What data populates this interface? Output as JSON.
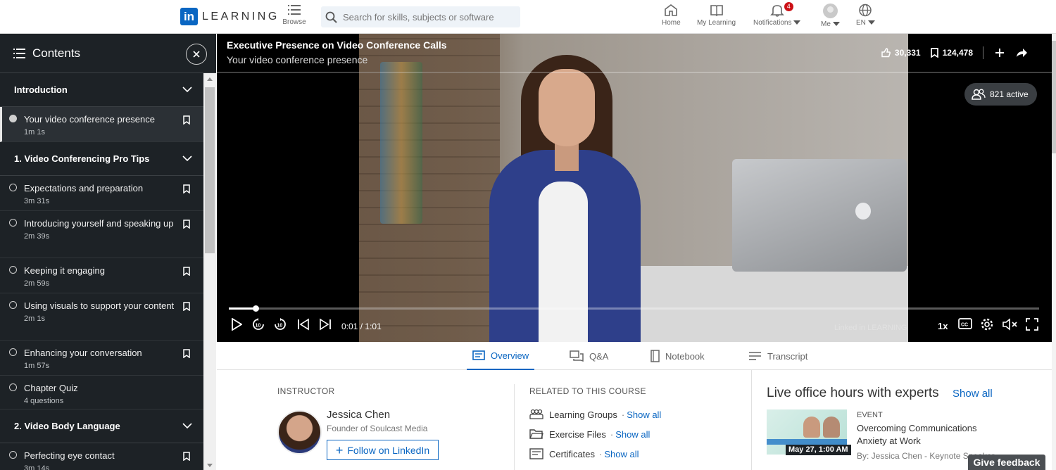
{
  "nav": {
    "logo_letters": "in",
    "logo_text": "LEARNING",
    "browse_label": "Browse",
    "search_placeholder": "Search for skills, subjects or software",
    "home_label": "Home",
    "my_learning_label": "My Learning",
    "notifications_label": "Notifications",
    "notifications_count": "4",
    "me_label": "Me",
    "lang_label": "EN"
  },
  "sidebar": {
    "title": "Contents",
    "sections": [
      {
        "title": "Introduction",
        "items": [
          {
            "title": "Your video conference presence",
            "duration": "1m 1s"
          }
        ]
      },
      {
        "title": "1. Video Conferencing Pro Tips",
        "items": [
          {
            "title": "Expectations and preparation",
            "duration": "3m 31s"
          },
          {
            "title": "Introducing yourself and speaking up",
            "duration": "2m 39s"
          },
          {
            "title": "Keeping it engaging",
            "duration": "2m 59s"
          },
          {
            "title": "Using visuals to support your content",
            "duration": "2m 1s"
          },
          {
            "title": "Enhancing your conversation",
            "duration": "1m 57s"
          },
          {
            "title": "Chapter Quiz",
            "duration": "4 questions"
          }
        ]
      },
      {
        "title": "2. Video Body Language",
        "items": [
          {
            "title": "Perfecting eye contact",
            "duration": "3m 14s"
          }
        ]
      }
    ]
  },
  "video": {
    "course_title": "Executive Presence on Video Conference Calls",
    "video_title": "Your video conference presence",
    "likes": "30,331",
    "saves": "124,478",
    "active_viewers": "821 active",
    "current_time": "0:01",
    "total_time": "1:01",
    "time_separator": "/",
    "progress_fraction": 0.033,
    "speed": "1x",
    "watermark": "Linked in LEARNING"
  },
  "tabs": {
    "overview": "Overview",
    "qa": "Q&A",
    "notebook": "Notebook",
    "transcript": "Transcript"
  },
  "instructor": {
    "label": "INSTRUCTOR",
    "name": "Jessica Chen",
    "role": "Founder of Soulcast Media",
    "follow_label": "Follow on LinkedIn"
  },
  "related": {
    "label": "RELATED TO THIS COURSE",
    "items": [
      {
        "title": "Learning Groups",
        "link": "Show all"
      },
      {
        "title": "Exercise Files",
        "link": "Show all"
      },
      {
        "title": "Certificates",
        "link": "Show all"
      }
    ]
  },
  "live": {
    "title": "Live office hours with experts",
    "show_all": "Show all",
    "event_type": "EVENT",
    "event_title": "Overcoming Communications Anxiety at Work",
    "event_date": "May 27, 1:00 AM",
    "event_by": "By: Jessica Chen - Keynote Speaker"
  },
  "feedback_label": "Give feedback",
  "colors": {
    "brand": "#0a66c2",
    "sidebar_bg": "#1d2226",
    "badge": "#cc1016"
  }
}
